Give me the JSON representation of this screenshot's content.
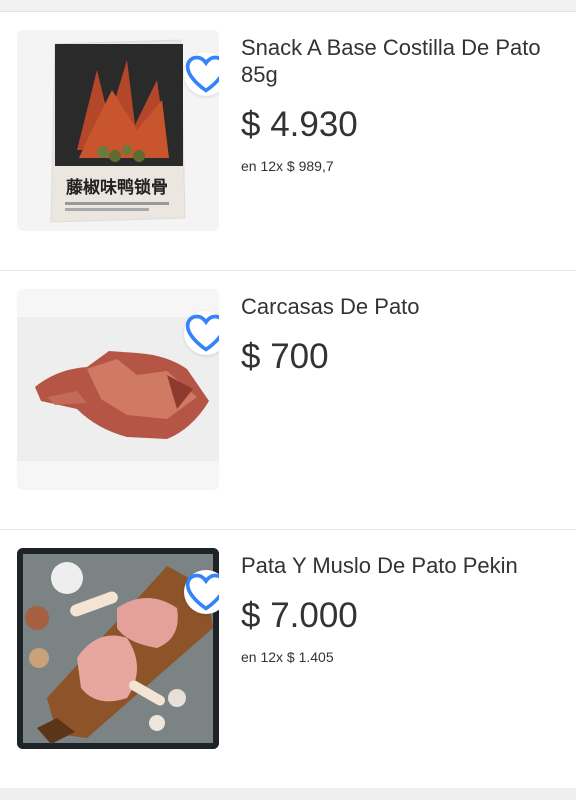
{
  "colors": {
    "accent": "#3483fa",
    "text": "#333333",
    "divider": "#e6e6e6"
  },
  "products": [
    {
      "title": "Snack A Base Costilla De Pato 85g",
      "price": "$ 4.930",
      "installments": "en 12x $ 989,7",
      "image_icon": "duck-snack-package-image",
      "package_text": "藤椒味鸭锁骨",
      "favorite_icon": "heart-outline-icon"
    },
    {
      "title": "Carcasas De Pato",
      "price": "$ 700",
      "installments": "",
      "image_icon": "duck-carcass-image",
      "favorite_icon": "heart-outline-icon"
    },
    {
      "title": "Pata Y Muslo De Pato Pekin",
      "price": "$ 7.000",
      "installments": "en 12x $ 1.405",
      "image_icon": "duck-leg-on-board-image",
      "favorite_icon": "heart-outline-icon"
    }
  ]
}
